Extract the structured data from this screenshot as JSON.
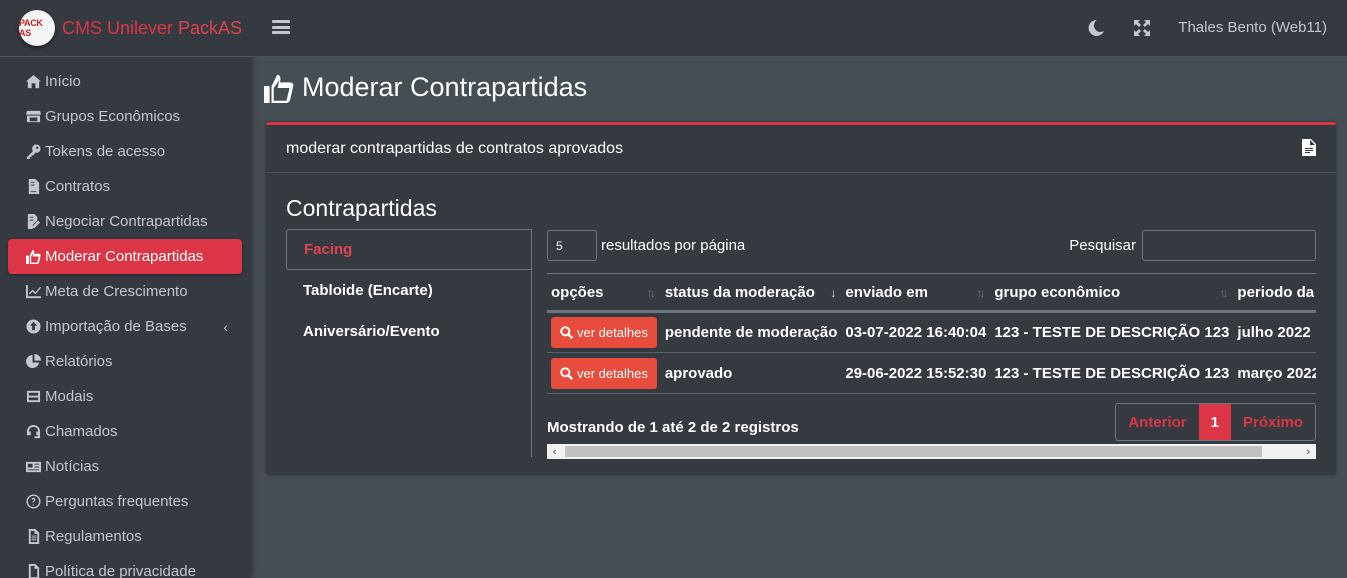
{
  "brand": {
    "logo_text": "PACK AS",
    "name_prefix": "CMS Unilever ",
    "name_suffix": "PackAS"
  },
  "sidebar": {
    "items": [
      {
        "label": "Início",
        "icon": "home-icon"
      },
      {
        "label": "Grupos Econômicos",
        "icon": "store-icon"
      },
      {
        "label": "Tokens de acesso",
        "icon": "key-icon"
      },
      {
        "label": "Contratos",
        "icon": "file-contract-icon"
      },
      {
        "label": "Negociar Contrapartidas",
        "icon": "file-signature-icon"
      },
      {
        "label": "Moderar Contrapartidas",
        "icon": "thumbs-up-icon",
        "active": true
      },
      {
        "label": "Meta de Crescimento",
        "icon": "chart-line-icon"
      },
      {
        "label": "Importação de Bases",
        "icon": "upload-icon"
      },
      {
        "label": "Relatórios",
        "icon": "pie-chart-icon"
      },
      {
        "label": "Modais",
        "icon": "mailbox-icon"
      },
      {
        "label": "Chamados",
        "icon": "headset-icon"
      },
      {
        "label": "Notícias",
        "icon": "newspaper-icon"
      },
      {
        "label": "Perguntas frequentes",
        "icon": "question-circle-icon"
      },
      {
        "label": "Regulamentos",
        "icon": "file-text-icon"
      },
      {
        "label": "Política de privacidade",
        "icon": "file-icon"
      }
    ]
  },
  "header": {
    "user": "Thales Bento (Web11)"
  },
  "page": {
    "title": "Moderar Contrapartidas"
  },
  "card": {
    "header": "moderar contrapartidas de contratos aprovados",
    "section_title": "Contrapartidas",
    "tabs": [
      "Facing",
      "Tabloide (Encarte)",
      "Aniversário/Evento"
    ],
    "length_value": "5",
    "length_label": "resultados por página",
    "search_label": "Pesquisar",
    "columns": [
      "opções",
      "status da moderação",
      "enviado em",
      "grupo econômico",
      "periodo da m"
    ],
    "rows": [
      {
        "button": "ver detalhes",
        "status": "pendente de moderação",
        "sent": "03-07-2022 16:40:04",
        "group": "123 - TESTE DE DESCRIÇÃO 123",
        "period": "julho 2022"
      },
      {
        "button": "ver detalhes",
        "status": "aprovado",
        "sent": "29-06-2022 15:52:30",
        "group": "123 - TESTE DE DESCRIÇÃO 123",
        "period": "março 2022"
      }
    ],
    "info": "Mostrando de 1 até 2 de 2 registros",
    "pager": {
      "prev": "Anterior",
      "current": "1",
      "next": "Próximo"
    }
  },
  "colors": {
    "accent": "#dc3545",
    "sidebar_bg": "#343a40",
    "body_bg": "#454d55"
  }
}
